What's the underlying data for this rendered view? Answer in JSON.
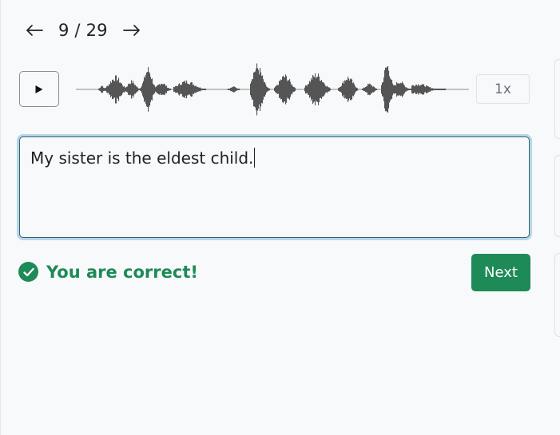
{
  "nav": {
    "prev_icon": "arrow-left-icon",
    "counter": "9 / 29",
    "next_icon": "arrow-right-icon"
  },
  "audio": {
    "play_icon": "play-icon",
    "speed": "1x"
  },
  "answer": {
    "text": "My sister is the eldest child."
  },
  "result": {
    "icon": "check-circle-icon",
    "message": "You are correct!",
    "color": "#1d8a57"
  },
  "actions": {
    "next_label": "Next"
  },
  "colors": {
    "accent": "#1d8a57",
    "focus_ring": "#b7d3ef",
    "waveform": "#555555"
  }
}
